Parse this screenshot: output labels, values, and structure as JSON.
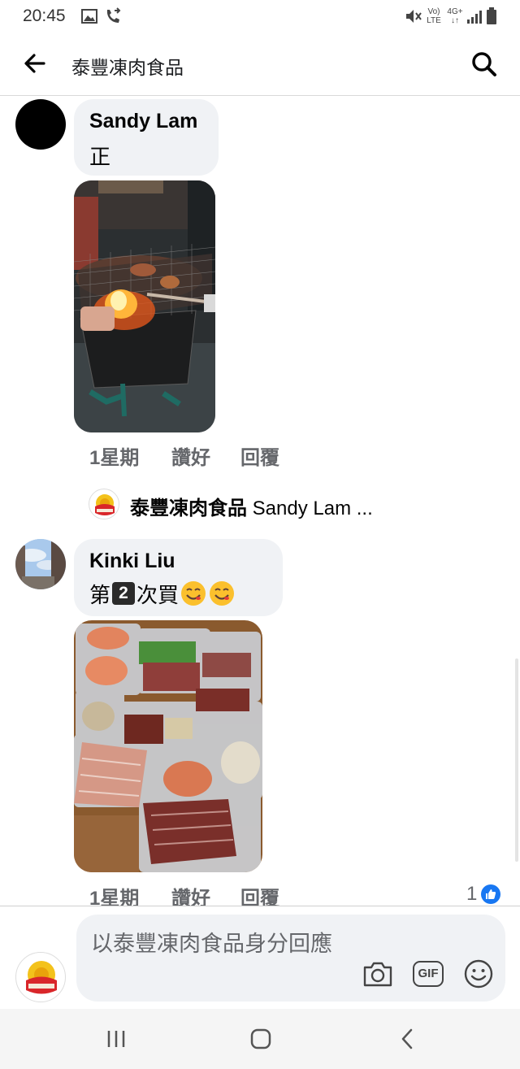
{
  "status_bar": {
    "time": "20:45",
    "icons": [
      "image-icon",
      "call-forward-icon",
      "mute-icon",
      "volte-icon",
      "4g-icon",
      "signal-icon",
      "battery-icon"
    ],
    "volte_top": "Vo)",
    "volte_bottom": "LTE",
    "network": "4G+"
  },
  "header": {
    "title": "泰豐凍肉食品",
    "back_icon": "back-arrow-icon",
    "search_icon": "search-icon"
  },
  "comments": [
    {
      "author": "Sandy Lam",
      "text": "正",
      "photo": "bbq-grill-photo",
      "time": "1星期",
      "like_label": "讚好",
      "reply_label": "回覆",
      "reply_preview": {
        "page": "泰豐凍肉食品",
        "text": "Sandy Lam ..."
      }
    },
    {
      "author": "Kinki Liu",
      "text_prefix": "第",
      "number_badge": "2",
      "text_suffix": "次買",
      "emojis": [
        "smiling-face-icon",
        "smiling-face-icon"
      ],
      "photo": "frozen-meat-photo",
      "time": "1星期",
      "like_label": "讚好",
      "reply_label": "回覆",
      "reaction_count": "1"
    }
  ],
  "composer": {
    "placeholder": "以泰豐凍肉食品身分回應",
    "icons": [
      "camera-icon",
      "gif-icon",
      "emoji-icon"
    ],
    "gif_label": "GIF"
  },
  "nav_bar": {
    "icons": [
      "recent-apps-icon",
      "home-icon",
      "back-nav-icon"
    ]
  },
  "colors": {
    "bubble": "#f0f2f5",
    "secondary_text": "#65676b",
    "like_blue": "#1877f2"
  }
}
